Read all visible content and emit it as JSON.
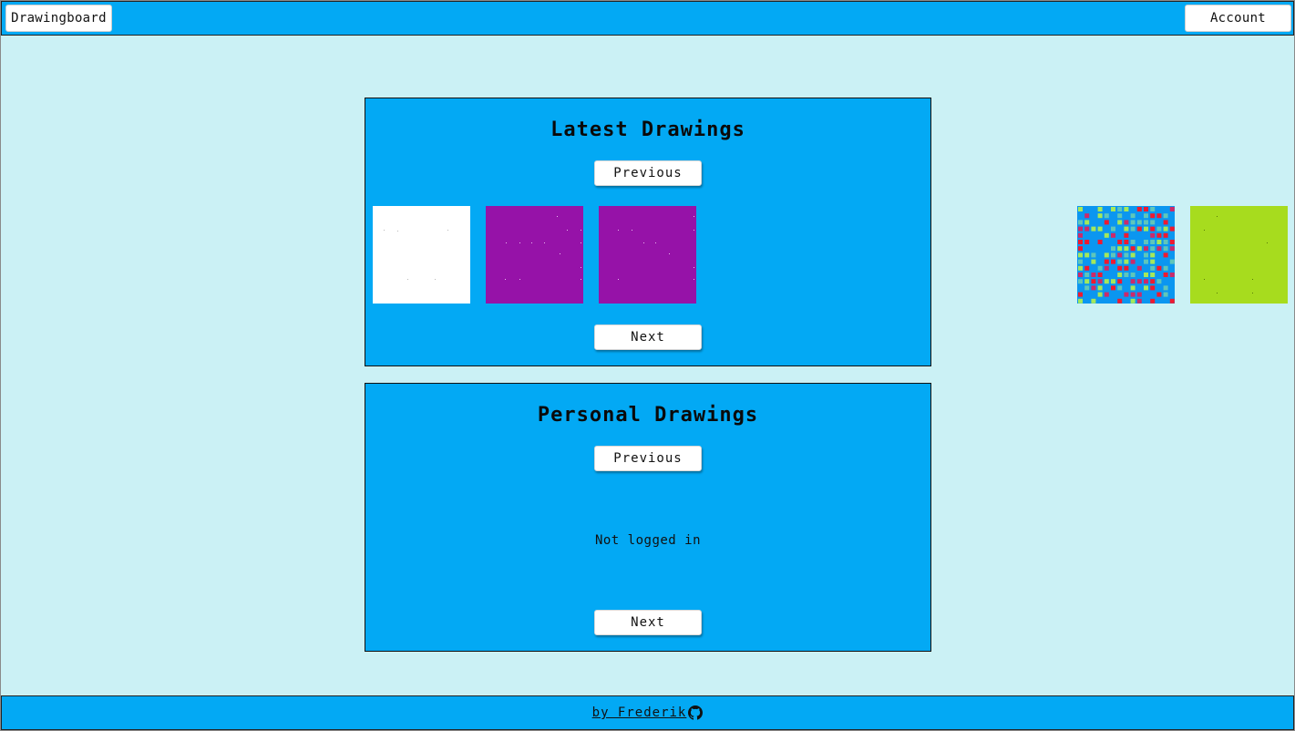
{
  "header": {
    "brand_label": "Drawingboard",
    "account_label": "Account"
  },
  "latest": {
    "title": "Latest Drawings",
    "previous_label": "Previous",
    "next_label": "Next",
    "drawings": [
      {
        "background": "#ffffff"
      },
      {
        "background": "#9612a8"
      },
      {
        "background": "#9612a8"
      },
      {
        "background": "#0b96f0",
        "accent_colors": [
          "#f0192f",
          "#5fc6b9",
          "#a5e85a",
          "#cc2a6a"
        ]
      },
      {
        "background": "#a7dc1e"
      }
    ]
  },
  "personal": {
    "title": "Personal Drawings",
    "previous_label": "Previous",
    "next_label": "Next",
    "status": "Not logged in"
  },
  "footer": {
    "credit_label": "by Frederik",
    "icon": "github-icon"
  },
  "colors": {
    "page_background": "#cbf1f5",
    "accent": "#03a9f4",
    "button": "#ffffff"
  }
}
